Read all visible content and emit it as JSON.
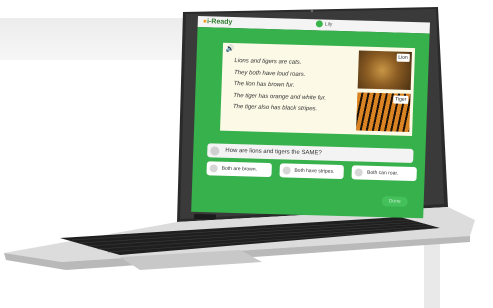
{
  "app": {
    "brand": "i-Ready",
    "user_name": "Lily"
  },
  "passage": {
    "lines": [
      "Lions and tigers are cats.",
      "They both have loud roars.",
      "The lion has brown fur.",
      "The tiger has orange and white fur.",
      "The tiger also has black stripes."
    ]
  },
  "images": {
    "lion_label": "Lion",
    "tiger_label": "Tiger"
  },
  "question": {
    "text": "How are lions and tigers the SAME?"
  },
  "answers": [
    {
      "text": "Both are brown."
    },
    {
      "text": "Both have stripes."
    },
    {
      "text": "Both can roar."
    }
  ],
  "submit_label": "Done",
  "colors": {
    "screen_bg": "#36b14b",
    "passage_bg": "#fcf9e6",
    "brand_green": "#2b7b2b",
    "brand_orange": "#f59c1b"
  }
}
